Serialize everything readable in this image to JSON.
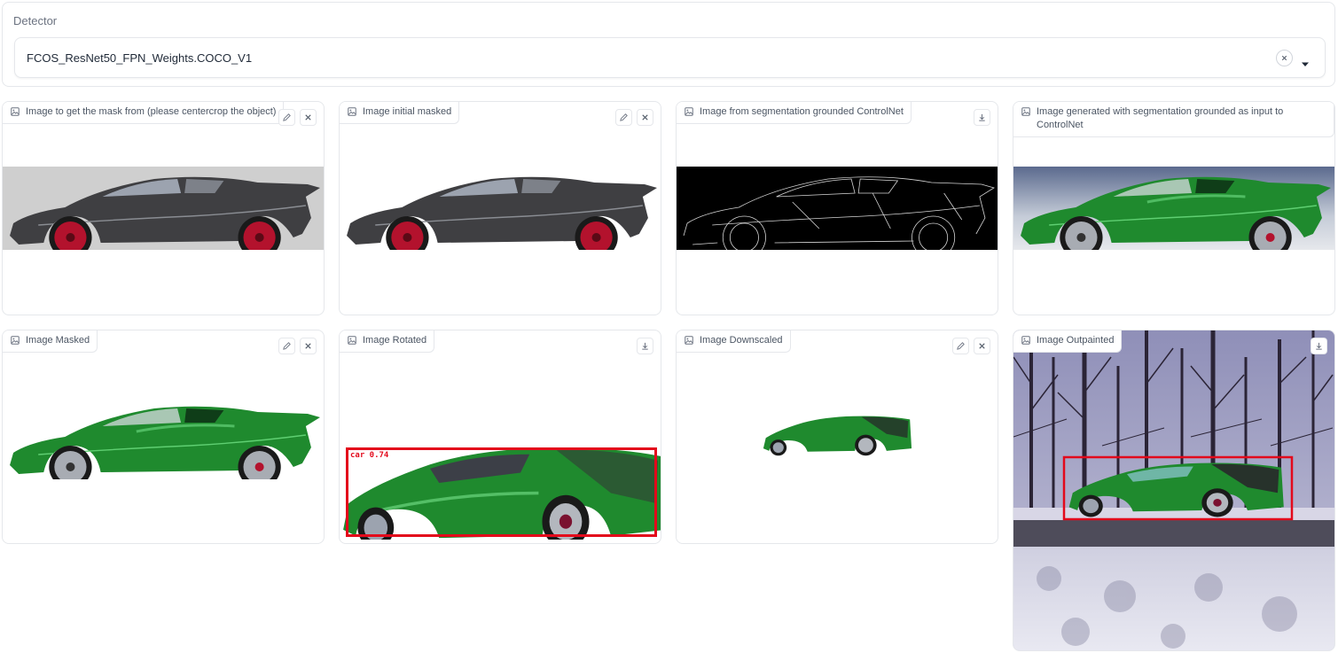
{
  "detector": {
    "label": "Detector",
    "selected": "FCOS_ResNet50_FPN_Weights.COCO_V1"
  },
  "panels": [
    {
      "label": "Image to get the mask from (please centercrop the object)",
      "tools": [
        "edit-icon",
        "close-icon"
      ]
    },
    {
      "label": "Image initial masked",
      "tools": [
        "edit-icon",
        "close-icon"
      ]
    },
    {
      "label": "Image from segmentation grounded ControlNet",
      "tools": [
        "download-icon"
      ]
    },
    {
      "label": "Image generated with segmentation grounded as input to ControlNet",
      "tools": []
    },
    {
      "label": "Image Masked",
      "tools": [
        "edit-icon",
        "close-icon"
      ]
    },
    {
      "label": "Image Rotated",
      "tools": [
        "download-icon"
      ],
      "detection_label": "car 0.74"
    },
    {
      "label": "Image Downscaled",
      "tools": [
        "edit-icon",
        "close-icon"
      ]
    },
    {
      "label": "Image Outpainted",
      "tools": [
        "download-icon"
      ]
    }
  ],
  "colors": {
    "car_gray": "#3f3f42",
    "car_green": "#1f8a2e",
    "wheel_red": "#b3122d",
    "bbox_red": "#e3091b"
  }
}
